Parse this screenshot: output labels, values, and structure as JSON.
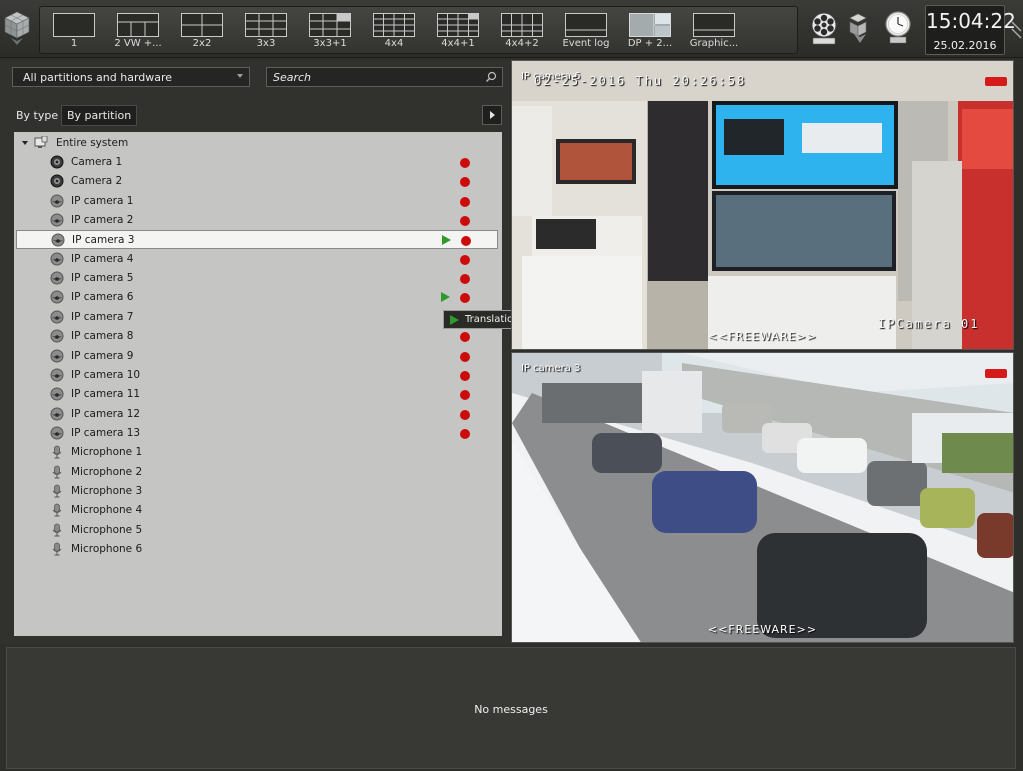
{
  "toolbar": {
    "layouts": [
      {
        "label": "1",
        "grid": "1"
      },
      {
        "label": "2 VW +...",
        "grid": "2vw"
      },
      {
        "label": "2x2",
        "grid": "2x2"
      },
      {
        "label": "3x3",
        "grid": "3x3"
      },
      {
        "label": "3x3+1",
        "grid": "3x3+1"
      },
      {
        "label": "4x4",
        "grid": "4x4"
      },
      {
        "label": "4x4+1",
        "grid": "4x4+1"
      },
      {
        "label": "4x4+2",
        "grid": "4x4+2"
      },
      {
        "label": "Event log",
        "grid": "log"
      },
      {
        "label": "DP + 2...",
        "grid": "dp",
        "active": true
      },
      {
        "label": "Graphic...",
        "grid": "graphic"
      }
    ],
    "tool_icons": [
      "film-reel-icon",
      "settings-cubes-icon",
      "clock-icon"
    ],
    "clock": {
      "time": "15:04:22",
      "date": "25.02.2016"
    }
  },
  "left_panel": {
    "partition_select": "All partitions and hardware",
    "search_placeholder": "Search",
    "tabs": [
      "By type",
      "By partition"
    ],
    "active_tab": "By partition",
    "tree": {
      "root": "Entire system",
      "items": [
        {
          "label": "Camera 1",
          "kind": "analog-camera",
          "status": "alarm"
        },
        {
          "label": "Camera 2",
          "kind": "analog-camera",
          "status": "alarm"
        },
        {
          "label": "IP camera 1",
          "kind": "dome-camera",
          "status": "alarm"
        },
        {
          "label": "IP camera 2",
          "kind": "dome-camera",
          "status": "alarm"
        },
        {
          "label": "IP camera 3",
          "kind": "dome-camera",
          "status": "alarm",
          "playing": true,
          "selected": true
        },
        {
          "label": "IP camera 4",
          "kind": "dome-camera",
          "status": "alarm"
        },
        {
          "label": "IP camera 5",
          "kind": "dome-camera",
          "status": "alarm"
        },
        {
          "label": "IP camera 6",
          "kind": "dome-camera",
          "status": "alarm",
          "playing": true
        },
        {
          "label": "IP camera 7",
          "kind": "dome-camera",
          "status": "alarm"
        },
        {
          "label": "IP camera 8",
          "kind": "dome-camera",
          "status": "alarm"
        },
        {
          "label": "IP camera 9",
          "kind": "dome-camera",
          "status": "alarm"
        },
        {
          "label": "IP camera 10",
          "kind": "dome-camera",
          "status": "alarm"
        },
        {
          "label": "IP camera 11",
          "kind": "dome-camera",
          "status": "alarm"
        },
        {
          "label": "IP camera 12",
          "kind": "dome-camera",
          "status": "alarm"
        },
        {
          "label": "IP camera 13",
          "kind": "dome-camera",
          "status": "alarm"
        },
        {
          "label": "Microphone 1",
          "kind": "microphone"
        },
        {
          "label": "Microphone 2",
          "kind": "microphone"
        },
        {
          "label": "Microphone 3",
          "kind": "microphone"
        },
        {
          "label": "Microphone 4",
          "kind": "microphone"
        },
        {
          "label": "Microphone 5",
          "kind": "microphone"
        },
        {
          "label": "Microphone 6",
          "kind": "microphone"
        }
      ]
    },
    "tooltip": "Translation"
  },
  "video": {
    "top": {
      "label": "IP camera 6",
      "osd_datetime": "02-25-2016 Thu 20:26:58",
      "osd_name": "IPCamera 01",
      "watermark": "<<FREEWARE>>",
      "rec_label": "Rec"
    },
    "bottom": {
      "label": "IP camera 3",
      "watermark": "<<FREEWARE>>",
      "rec_label": "Rec"
    }
  },
  "messages": {
    "text": "No messages"
  }
}
